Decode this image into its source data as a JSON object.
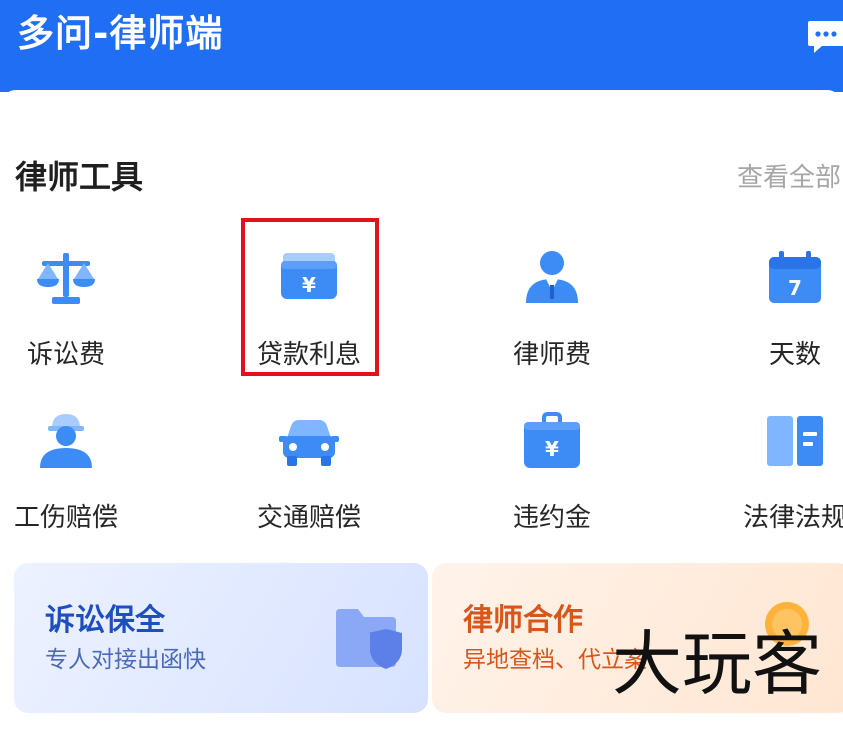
{
  "app": {
    "title": "多问-律师端"
  },
  "header": {
    "message_icon": "message-dots-icon"
  },
  "section": {
    "title": "律师工具",
    "view_all": "查看全部"
  },
  "tools": [
    {
      "label": "诉讼费",
      "icon": "scales-icon"
    },
    {
      "label": "贷款利息",
      "icon": "wallet-yuan-icon",
      "highlighted": true
    },
    {
      "label": "律师费",
      "icon": "lawyer-avatar-icon"
    },
    {
      "label": "天数",
      "icon": "calendar-icon"
    },
    {
      "label": "工伤赔偿",
      "icon": "worker-icon"
    },
    {
      "label": "交通赔偿",
      "icon": "car-icon"
    },
    {
      "label": "违约金",
      "icon": "briefcase-yuan-icon"
    },
    {
      "label": "法律法规",
      "icon": "law-book-icon"
    }
  ],
  "cards": {
    "litigation": {
      "title": "诉讼保全",
      "subtitle": "专人对接出函快",
      "icon": "folder-shield-icon"
    },
    "cooperation": {
      "title": "律师合作",
      "subtitle": "异地查档、代立案",
      "icon": "coin-icon"
    }
  },
  "watermark": "大玩客",
  "colors": {
    "brand": "#1f6ef3",
    "highlight": "#e2121b",
    "icon_blue": "#3d8bf5",
    "cooperation_accent": "#d8561a"
  }
}
